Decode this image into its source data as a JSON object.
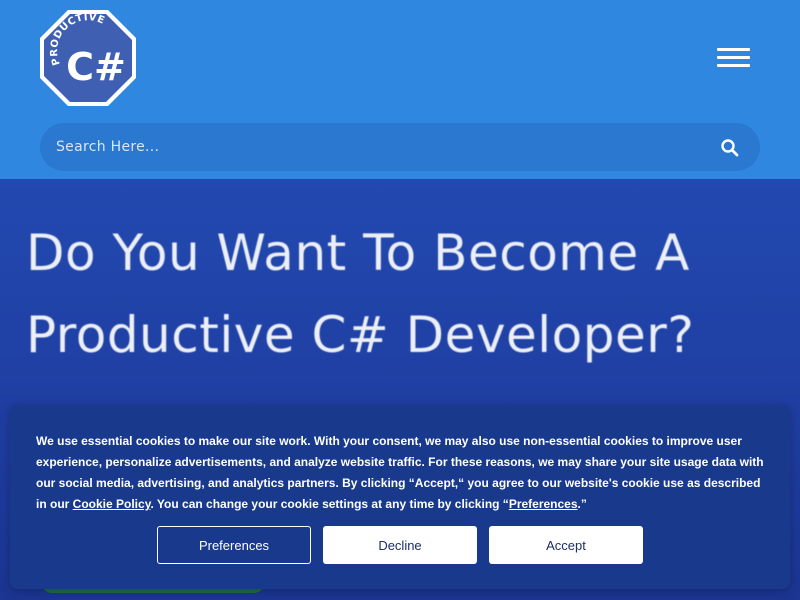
{
  "header": {
    "logo_text_top": "PRODUCTIVE",
    "logo_text_main": "C#",
    "menu_icon": "hamburger-menu-icon"
  },
  "search": {
    "placeholder": "Search Here...",
    "icon": "search-icon"
  },
  "hero": {
    "title": "Do You Want To Become A Productive C# Developer?"
  },
  "cookie_banner": {
    "text_part1": "We use essential cookies to make our site work. With your consent, we may also use non-essential cookies to improve user experience, personalize advertisements, and analyze website traffic. For these reasons, we may share your site usage data with our social media, advertising, and analytics partners. By clicking “Accept,“ you agree to our website's cookie use as described in our ",
    "policy_link": "Cookie Policy",
    "text_part2": ". You can change your cookie settings at any time by clicking “",
    "preferences_link": "Preferences",
    "text_part3": ".”",
    "buttons": {
      "preferences": "Preferences",
      "decline": "Decline",
      "accept": "Accept"
    }
  },
  "colors": {
    "header_bg": "#2f87e0",
    "hero_bg": "#2249b0",
    "banner_bg": "#193a8c",
    "logo_bg": "#3f5fb3"
  }
}
